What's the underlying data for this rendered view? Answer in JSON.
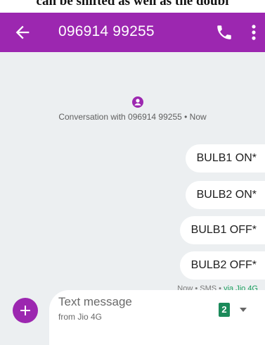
{
  "page_caption_fragment": "can be shifted as well as the doubl",
  "header": {
    "title": "096914 99255",
    "background_color": "#9c27b0",
    "icons": [
      "arrow-left-icon",
      "phone-icon",
      "more-vert-icon"
    ]
  },
  "conversation": {
    "info": "Conversation with 096914 99255 • Now",
    "background_color": "#eceff1",
    "messages": [
      {
        "text": "BULB1 ON*"
      },
      {
        "text": "BULB2 ON*"
      },
      {
        "text": "BULB1 OFF*"
      },
      {
        "text": "BULB2 OFF*"
      }
    ],
    "meta": {
      "time": "Now",
      "type": "SMS",
      "via": "via Jio 4G",
      "separator": " • "
    }
  },
  "compose": {
    "placeholder": "Text message",
    "sub_label": "from Jio 4G",
    "sim_number": "2",
    "sim_color": "#1b8a5a"
  }
}
